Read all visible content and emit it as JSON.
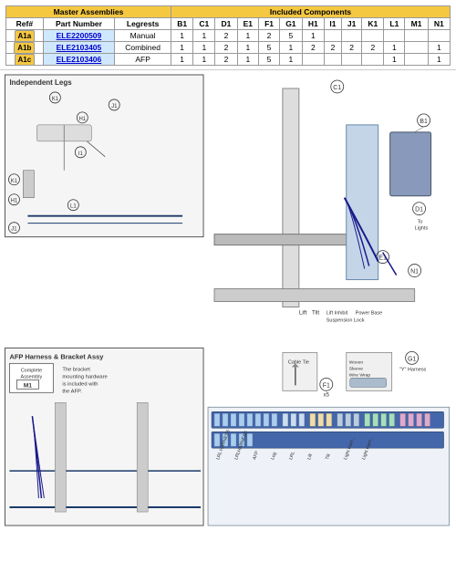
{
  "table": {
    "header_master": "Master Assemblies",
    "header_included": "Included Components",
    "col_headers": [
      "Ref#",
      "Part Number",
      "Legrests",
      "B1",
      "C1",
      "D1",
      "E1",
      "F1",
      "G1",
      "H1",
      "I1",
      "J1",
      "K1",
      "L1",
      "M1",
      "N1"
    ],
    "rows": [
      {
        "ref": "A1a",
        "part_number": "ELE2200509",
        "legrests": "Manual",
        "values": [
          "1",
          "1",
          "2",
          "1",
          "2",
          "5",
          "1",
          "",
          "",
          "",
          "",
          "",
          "",
          ""
        ]
      },
      {
        "ref": "A1b",
        "part_number": "ELE2103405",
        "legrests": "Combined",
        "values": [
          "1",
          "1",
          "2",
          "1",
          "5",
          "1",
          "2",
          "2",
          "2",
          "2",
          "1",
          "",
          "1"
        ]
      },
      {
        "ref": "A1c",
        "part_number": "ELE2103406",
        "legrests": "AFP",
        "values": [
          "1",
          "1",
          "2",
          "1",
          "5",
          "1",
          "",
          "",
          "",
          "",
          "1",
          "",
          "1"
        ]
      }
    ]
  },
  "diagram": {
    "indep_box_label": "Independent Legs",
    "afp_box_label": "AFP Harness & Bracket Assy",
    "complete_assembly_label": "Complete Assembly",
    "m1_label": "M1",
    "afp_note": "The bracket mounting hardware is included with the AFP.",
    "callouts": {
      "C1": "C1",
      "B1": "B1",
      "D1": "D1",
      "E1": "E1",
      "N1": "N1",
      "K1": "K1",
      "H1": "H1",
      "J1": "J1",
      "I1": "I1",
      "L1": "L1",
      "Lift": "Lift",
      "Tilt": "Tilt",
      "LiftInhibit": "Lift Inhibit",
      "SuspensionLock": "Suspension Lock",
      "PowerBase": "Power Base",
      "ToLights": "To Lights",
      "CableTie": "Cable Tie",
      "WovenSleeve": "Woven Sleeve Wire Wrap",
      "F1": "F1",
      "x5": "x5",
      "G1": "G1",
      "YHarness": "\"Y\" Harness"
    }
  }
}
